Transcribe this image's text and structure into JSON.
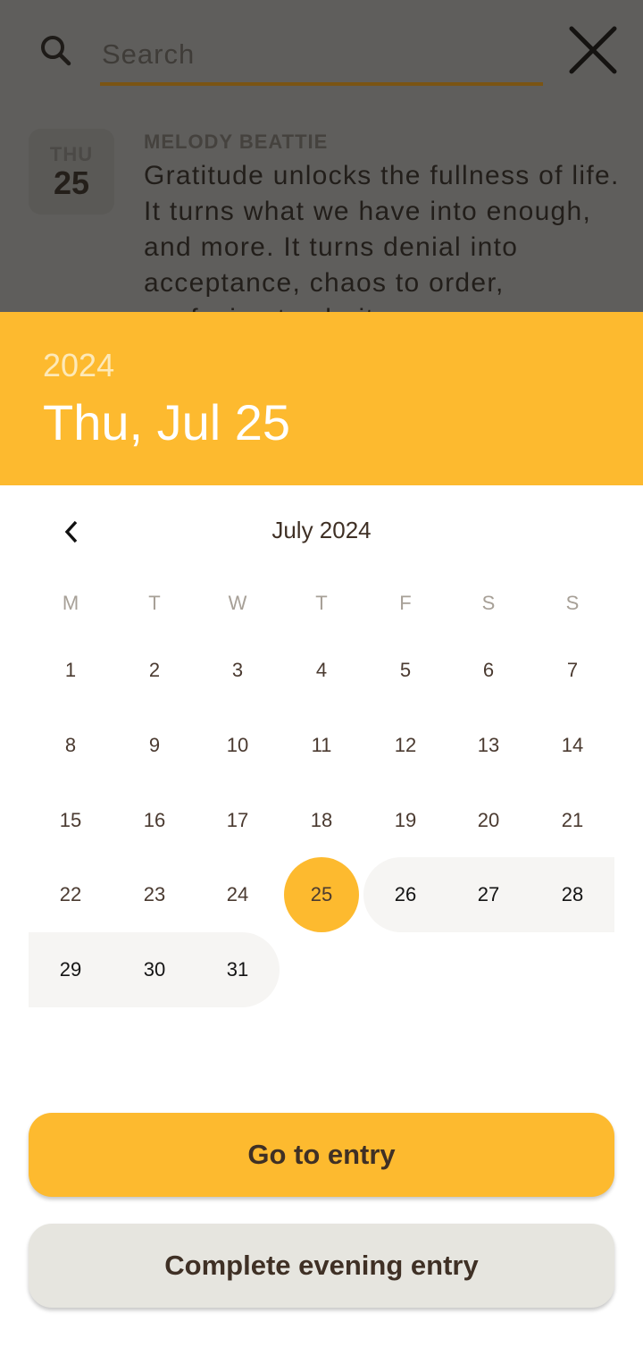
{
  "search": {
    "placeholder": "Search",
    "value": ""
  },
  "entry": {
    "day_of_week": "THU",
    "day": "25",
    "author": "MELODY BEATTIE",
    "quote": "Gratitude unlocks the fullness of life. It turns what we have into enough, and more. It turns denial into acceptance, chaos to order, confusion to clarity."
  },
  "picker": {
    "year": "2024",
    "selected_date": "Thu, Jul 25",
    "month_title": "July 2024",
    "weekdays": [
      "M",
      "T",
      "W",
      "T",
      "F",
      "S",
      "S"
    ],
    "days": [
      "1",
      "2",
      "3",
      "4",
      "5",
      "6",
      "7",
      "8",
      "9",
      "10",
      "11",
      "12",
      "13",
      "14",
      "15",
      "16",
      "17",
      "18",
      "19",
      "20",
      "21",
      "22",
      "23",
      "24",
      "25",
      "26",
      "27",
      "28",
      "29",
      "30",
      "31"
    ],
    "selected_day": 25,
    "first_weekday_index": 0
  },
  "actions": {
    "go_to_entry": "Go to entry",
    "complete_evening": "Complete evening entry"
  },
  "colors": {
    "accent": "#fdba2f",
    "text_brown": "#3f3025",
    "range_bg": "#f6f5f3",
    "secondary_button": "#e6e5df"
  }
}
